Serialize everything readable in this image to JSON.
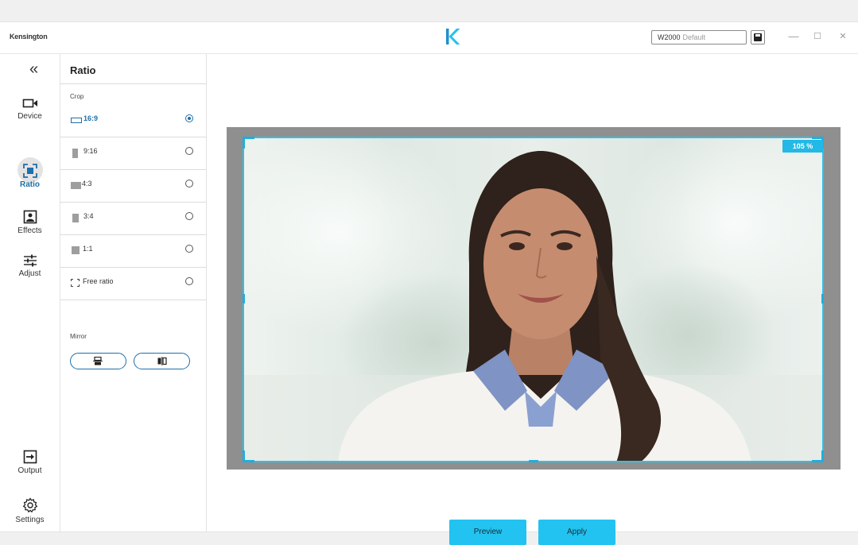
{
  "app": {
    "brand": "Kensington",
    "profile_name": "W2000",
    "profile_preset": "Default",
    "save_icon": "save-icon",
    "controls": {
      "minimize": "—",
      "maximize": "☐",
      "close": "✕"
    },
    "accent_color": "#22c3f0",
    "active_color": "#1d6fa8"
  },
  "nav": {
    "collapse_icon": "«",
    "items": [
      {
        "label": "Device",
        "icon": "camera-icon"
      },
      {
        "label": "Ratio",
        "icon": "ratio-icon",
        "active": true
      },
      {
        "label": "Effects",
        "icon": "portrait-icon"
      },
      {
        "label": "Adjust",
        "icon": "sliders-icon"
      },
      {
        "label": "Output",
        "icon": "output-icon"
      },
      {
        "label": "Settings",
        "icon": "gear-icon"
      }
    ]
  },
  "panel": {
    "title": "Ratio",
    "crop_label": "Crop",
    "mirror_label": "Mirror",
    "options": [
      {
        "label": "16:9",
        "selected": true
      },
      {
        "label": "9:16",
        "selected": false
      },
      {
        "label": "4:3",
        "selected": false
      },
      {
        "label": "3:4",
        "selected": false
      },
      {
        "label": "1:1",
        "selected": false
      },
      {
        "label": "Free ratio",
        "selected": false
      }
    ]
  },
  "preview": {
    "zoom": "105 %",
    "preview_label": "Preview",
    "apply_label": "Apply"
  }
}
